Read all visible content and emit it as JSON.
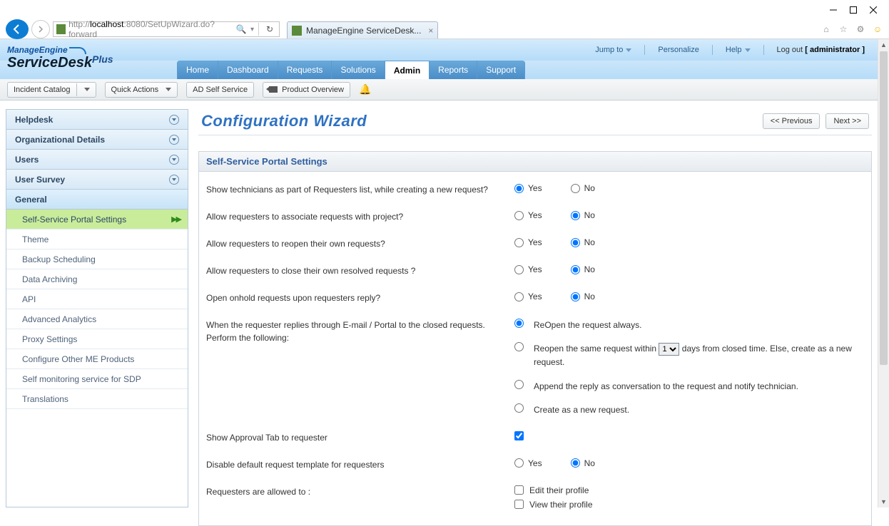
{
  "browser": {
    "url_prefix": "http://",
    "url_host": "localhost",
    "url_rest": ":8080/SetUpWizard.do?forward",
    "tab_title": "ManageEngine ServiceDesk..."
  },
  "logo": {
    "line1": "ManageEngine",
    "line2": "ServiceDesk",
    "plus": "Plus"
  },
  "top": {
    "jump": "Jump to",
    "personalize": "Personalize",
    "help": "Help",
    "logout": "Log out",
    "user": "[ administrator ]"
  },
  "tabs": [
    "Home",
    "Dashboard",
    "Requests",
    "Solutions",
    "Admin",
    "Reports",
    "Support"
  ],
  "tabs_active_index": 4,
  "subbar": {
    "incident": "Incident Catalog",
    "quick": "Quick Actions",
    "adself": "AD Self Service",
    "overview": "Product Overview"
  },
  "side": {
    "sections": [
      "Helpdesk",
      "Organizational Details",
      "Users",
      "User Survey",
      "General"
    ],
    "general_items": [
      "Self-Service Portal Settings",
      "Theme",
      "Backup Scheduling",
      "Data Archiving",
      "API",
      "Advanced Analytics",
      "Proxy Settings",
      "Configure Other ME Products",
      "Self monitoring service for SDP",
      "Translations"
    ]
  },
  "wizard": {
    "title": "Configuration Wizard",
    "prev": "<< Previous",
    "next": "Next >>"
  },
  "panel_title": "Self-Service Portal Settings",
  "labels": {
    "yes": "Yes",
    "no": "No"
  },
  "questions": {
    "q1": "Show technicians as part of Requesters list, while creating a new request?",
    "q2": "Allow requesters to associate requests with project?",
    "q3": "Allow requesters to reopen their own requests?",
    "q4": "Allow requesters to close their own resolved requests ?",
    "q5": "Open onhold requests upon requesters reply?",
    "q6": "When the requester replies through E-mail / Portal to the closed requests. Perform the following:",
    "q6_opts": {
      "a": "ReOpen the request always.",
      "b_pre": "Reopen the same request within",
      "b_post": "days from closed time. Else, create as a new request.",
      "c": "Append the reply as conversation to the request and notify technician.",
      "d": "Create as a new request."
    },
    "q6_sel": "1",
    "q7": "Show Approval Tab to requester",
    "q8": "Disable default request template for requesters",
    "q9": "Requesters are allowed to :",
    "q9_opts": {
      "a": "Edit their profile",
      "b": "View their profile"
    }
  }
}
